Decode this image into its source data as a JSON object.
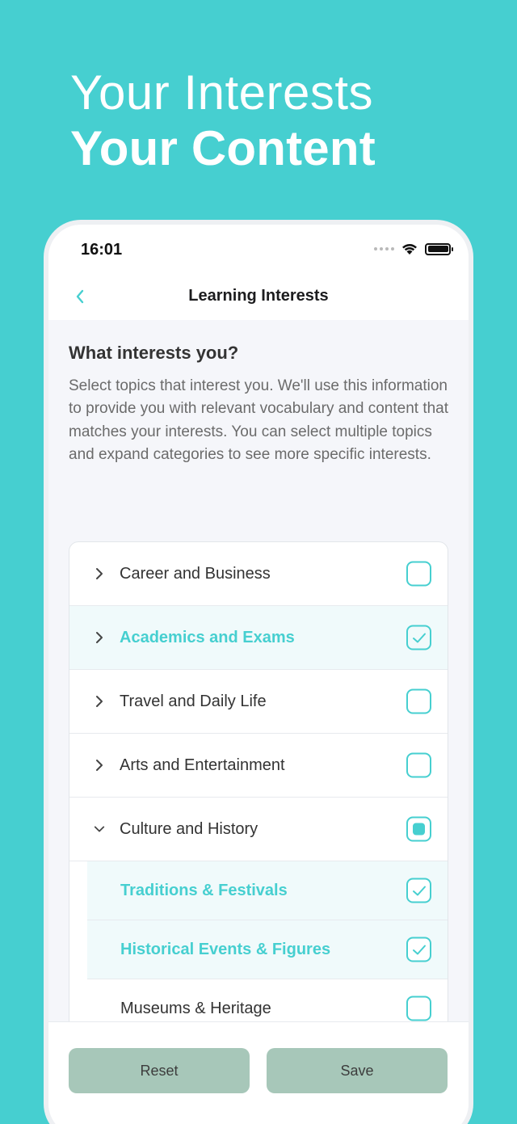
{
  "hero": {
    "line1": "Your Interests",
    "line2": "Your Content"
  },
  "status_bar": {
    "time": "16:01"
  },
  "nav": {
    "title": "Learning Interests"
  },
  "intro": {
    "title": "What interests you?",
    "description": "Select topics that interest you. We'll use this information to provide you with relevant vocabulary and content that matches your interests. You can select multiple topics and expand categories to see more specific interests."
  },
  "categories": [
    {
      "label": "Career and Business",
      "state": "unchecked",
      "expanded": false
    },
    {
      "label": "Academics and Exams",
      "state": "checked",
      "expanded": false
    },
    {
      "label": "Travel and Daily Life",
      "state": "unchecked",
      "expanded": false
    },
    {
      "label": "Arts and Entertainment",
      "state": "unchecked",
      "expanded": false
    },
    {
      "label": "Culture and History",
      "state": "partial",
      "expanded": true
    }
  ],
  "subcategories": [
    {
      "label": "Traditions & Festivals",
      "state": "checked"
    },
    {
      "label": "Historical Events & Figures",
      "state": "checked"
    },
    {
      "label": "Museums & Heritage",
      "state": "unchecked"
    }
  ],
  "footer": {
    "reset_label": "Reset",
    "save_label": "Save"
  },
  "colors": {
    "background": "#46cfd0",
    "accent": "#46cfd0",
    "button": "#a7c7b9"
  }
}
